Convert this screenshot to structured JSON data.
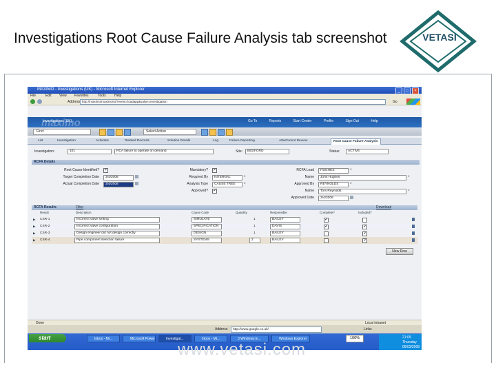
{
  "slide": {
    "title": "Investigations Root Cause Failure Analysis tab screenshot",
    "logo_text": "VETASI",
    "watermark": "www.vetasi.com"
  },
  "window": {
    "title": "MAXIMO - Investigations (UK) - Microsoft Internet Explorer",
    "menu": [
      "File",
      "Edit",
      "View",
      "Favorites",
      "Tools",
      "Help"
    ],
    "address_label": "Address",
    "address_url": "http://maximo/maximo/ui/?event=loadapp&value=investigation",
    "go_label": "Go",
    "controls": [
      "_",
      "□",
      "×"
    ]
  },
  "maximo": {
    "brand": "maximo",
    "app_name": "Investigations (UK)",
    "links": [
      "Go To",
      "Reports",
      "Start Center",
      "Profile",
      "Sign Out",
      "Help"
    ],
    "find_label": "Find:",
    "action_placeholder": "Select Action"
  },
  "tabs": [
    {
      "label": "List",
      "selected": false
    },
    {
      "label": "Investigation",
      "selected": false
    },
    {
      "label": "Activities",
      "selected": false
    },
    {
      "label": "Related Records",
      "selected": false
    },
    {
      "label": "Solution Details",
      "selected": false
    },
    {
      "label": "Log",
      "selected": false
    },
    {
      "label": "Failure Reporting",
      "selected": false
    },
    {
      "label": "Attachment Review",
      "selected": false
    },
    {
      "label": "Root Cause Failure Analysis",
      "selected": true
    }
  ],
  "record": {
    "investigation_label": "Investigation:",
    "investigation_value": "101",
    "description_value": "RCA failure to operate on demand",
    "site_label": "Site:",
    "site_value": "BEDFORD",
    "status_label": "Status:",
    "status_value": "ACTIVE"
  },
  "rcfa": {
    "section_title": "RCFA Details",
    "root_cause_label": "Root Cause Identified?",
    "target_date_label": "Target Completion Date",
    "target_date_value": "3/4/2008",
    "actual_date_label": "Actual Completion Date",
    "actual_date_value": "3/4/2008",
    "mandatory_label": "Mandatory?",
    "required_by_label": "Required By",
    "required_by_value": "INTERNAL",
    "analysis_type_label": "Analysis Type",
    "analysis_type_value": "CAUSE TREE",
    "approved_label": "Approved?",
    "lead_label": "RCFA Lead",
    "lead_value": "HUGHES",
    "name1_label": "Name",
    "name1_value": "John Hughes",
    "approved_by_label": "Approved By",
    "approved_by_value": "REYNOLDS",
    "name2_label": "Name",
    "name2_value": "Tom Reynolds",
    "approved_date_label": "Approved Date",
    "approved_date_value": "3/4/2008",
    "check_mark": "✔"
  },
  "results": {
    "section_title": "RCFA Results",
    "filter_label": "Filter",
    "download_label": "Download",
    "columns": [
      "Result",
      "Description",
      "Cause Code",
      "Quantity",
      "Responsible",
      "Complete?",
      "Included?"
    ],
    "rows": [
      {
        "result": "CSR-1",
        "description": "Incorrect valve setting",
        "cause": "SIMULATE",
        "qty": "1",
        "resp": "BAILEY",
        "complete": true,
        "included": false
      },
      {
        "result": "CSR-2",
        "description": "Incorrect valve configuration",
        "cause": "SPECIFICATION",
        "qty": "1",
        "resp": "DAVIS",
        "complete": true,
        "included": true
      },
      {
        "result": "CSR-3",
        "description": "Design engineer did not design correctly",
        "cause": "DESIGN",
        "qty": "1",
        "resp": "BAILEY",
        "complete": false,
        "included": true
      },
      {
        "result": "CSR-4",
        "description": "Pipe component selection failure",
        "cause": "SYSTEMS",
        "qty": "2",
        "resp": "BAILEY",
        "complete": false,
        "included": true
      }
    ],
    "new_row_label": "New Row"
  },
  "status": {
    "done": "Done",
    "zone": "Local intranet"
  },
  "taskbar": {
    "start_label": "start",
    "address_label": "Address",
    "address_value": "http://www.google.co.uk/",
    "links_label": "Links",
    "zoom": "100%",
    "tasks": [
      "Inbox - Mi...",
      "Microsoft PowerP...",
      "Investigat...",
      "Inbox - Mi...",
      "3 Windows E...",
      "Windows Explorer"
    ],
    "active_task": 2,
    "clock_time": "21:09",
    "clock_day": "Thursday",
    "clock_date": "06/03/2008"
  }
}
